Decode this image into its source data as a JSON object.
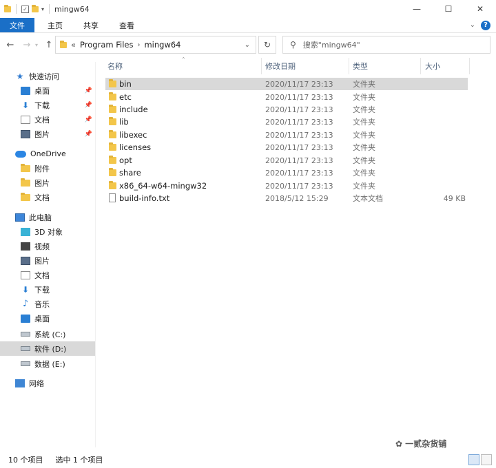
{
  "window": {
    "title": "mingw64",
    "controls": {
      "minimize": "—",
      "maximize": "☐",
      "close": "✕"
    }
  },
  "ribbon": {
    "tabs": [
      "文件",
      "主页",
      "共享",
      "查看"
    ],
    "help": "?"
  },
  "address": {
    "overflow": "«",
    "crumbs": [
      "Program Files",
      "mingw64"
    ],
    "search_placeholder": "搜索\"mingw64\""
  },
  "sidebar": {
    "quick_access": "快速访问",
    "quick_items": [
      "桌面",
      "下载",
      "文档",
      "图片"
    ],
    "onedrive": "OneDrive",
    "onedrive_items": [
      "附件",
      "图片",
      "文档"
    ],
    "this_pc": "此电脑",
    "pc_items": [
      "3D 对象",
      "视频",
      "图片",
      "文档",
      "下载",
      "音乐",
      "桌面",
      "系统 (C:)",
      "软件 (D:)",
      "数据 (E:)"
    ],
    "network": "网络"
  },
  "columns": {
    "name": "名称",
    "date": "修改日期",
    "type": "类型",
    "size": "大小"
  },
  "files": [
    {
      "name": "bin",
      "date": "2020/11/17 23:13",
      "type": "文件夹",
      "size": ""
    },
    {
      "name": "etc",
      "date": "2020/11/17 23:13",
      "type": "文件夹",
      "size": ""
    },
    {
      "name": "include",
      "date": "2020/11/17 23:13",
      "type": "文件夹",
      "size": ""
    },
    {
      "name": "lib",
      "date": "2020/11/17 23:13",
      "type": "文件夹",
      "size": ""
    },
    {
      "name": "libexec",
      "date": "2020/11/17 23:13",
      "type": "文件夹",
      "size": ""
    },
    {
      "name": "licenses",
      "date": "2020/11/17 23:13",
      "type": "文件夹",
      "size": ""
    },
    {
      "name": "opt",
      "date": "2020/11/17 23:13",
      "type": "文件夹",
      "size": ""
    },
    {
      "name": "share",
      "date": "2020/11/17 23:13",
      "type": "文件夹",
      "size": ""
    },
    {
      "name": "x86_64-w64-mingw32",
      "date": "2020/11/17 23:13",
      "type": "文件夹",
      "size": ""
    },
    {
      "name": "build-info.txt",
      "date": "2018/5/12 15:29",
      "type": "文本文档",
      "size": "49 KB"
    }
  ],
  "status": {
    "count": "10 个项目",
    "selected": "选中 1 个项目"
  },
  "watermark": "一贰杂货铺",
  "colors": {
    "accent": "#1a6fc7",
    "folder": "#f3c64a",
    "selection": "#d9d9d9"
  }
}
